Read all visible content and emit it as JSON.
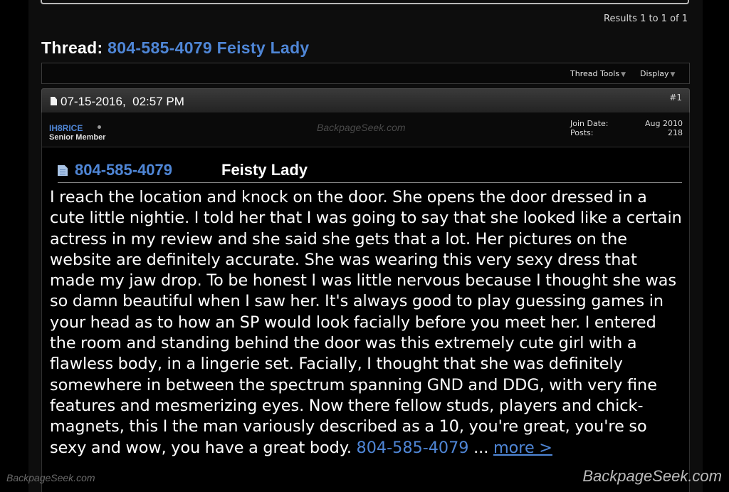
{
  "results_text": "Results 1 to 1 of 1",
  "thread": {
    "label": "Thread:",
    "title": "804-585-4079 Feisty Lady"
  },
  "toolbar": {
    "thread_tools": "Thread Tools",
    "display": "Display"
  },
  "post": {
    "date": "07-15-2016,  02:57 PM",
    "number": "#1",
    "author": "IH8RICE",
    "user_title": "Senior Member",
    "join_date_label": "Join Date:",
    "join_date_value": "Aug 2010",
    "posts_label": "Posts:",
    "posts_value": "218",
    "title_phone": "804-585-4079",
    "title_name": "Feisty Lady",
    "body": "I reach the location and knock on the door. She opens the door dressed in a cute little nightie. I told her that I was going to say that she looked like a certain actress in my review and she said she gets that a lot. Her pictures on the website are definitely accurate. She was wearing this very sexy dress that made my jaw drop. To be honest I was little nervous because I thought she was so damn beautiful when I saw her. It's always good to play guessing games in your head as to how an SP would look facially before you meet her. I entered the room and standing behind the door was this extremely cute girl with a flawless body, in a lingerie set. Facially, I thought that she was definitely somewhere in between the spectrum spanning GND and DDG, with very fine features and mesmerizing eyes. Now there fellow studs, players and chick-magnets, this I the man variously described as a 10, you're great, you're so sexy and wow, you have a great body. ",
    "body_link": "804-585-4079",
    "ellipsis": " ... ",
    "more_link": "more >"
  },
  "watermarks": {
    "center": "BackpageSeek.com",
    "bottom_left": "BackpageSeek.com",
    "bottom_right": "BackpageSeek.com"
  },
  "colors": {
    "link_blue": "#4f86d6",
    "background": "#000000"
  }
}
